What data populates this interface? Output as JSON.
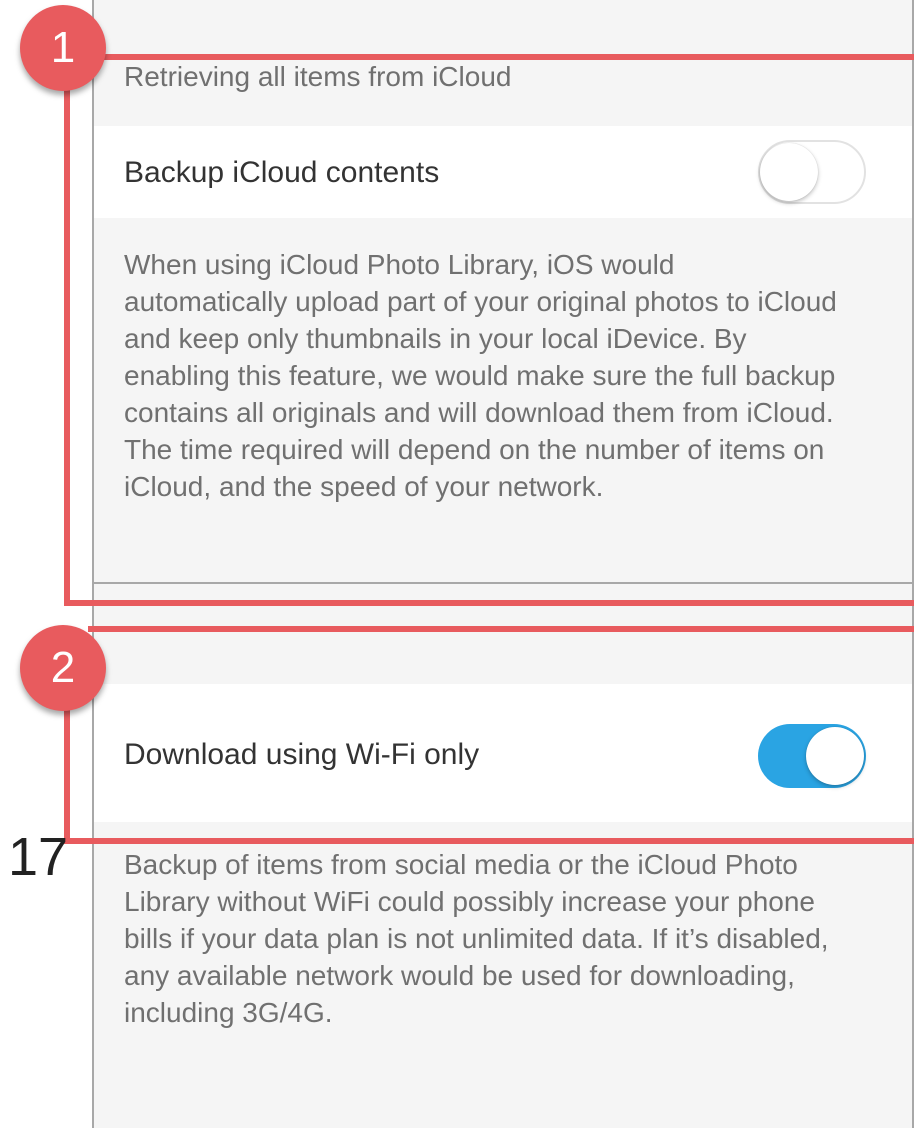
{
  "status_text": "Retrieving all items from iCloud",
  "backup_icloud": {
    "label": "Backup iCloud contents",
    "enabled": false,
    "description": "When using iCloud Photo Library, iOS would automatically upload part of your original photos to iCloud and keep only thumbnails in your local iDevice. By enabling this feature, we would make sure the full backup contains all originals and will download them from iCloud. The time required will depend on the number of items on iCloud, and the speed of your network."
  },
  "wifi_only": {
    "label": "Download using Wi-Fi only",
    "enabled": true,
    "description": "Backup of items from social media or the iCloud Photo Library without WiFi could possibly increase your phone bills if your data plan is not unlimited data. If it’s disabled, any available network would be used for downloading, including 3G/4G."
  },
  "annotations": [
    {
      "label": "1"
    },
    {
      "label": "2"
    }
  ],
  "page_number": "17",
  "colors": {
    "annotation": "#e85b5e",
    "toggle_on": "#2aa4e3"
  }
}
